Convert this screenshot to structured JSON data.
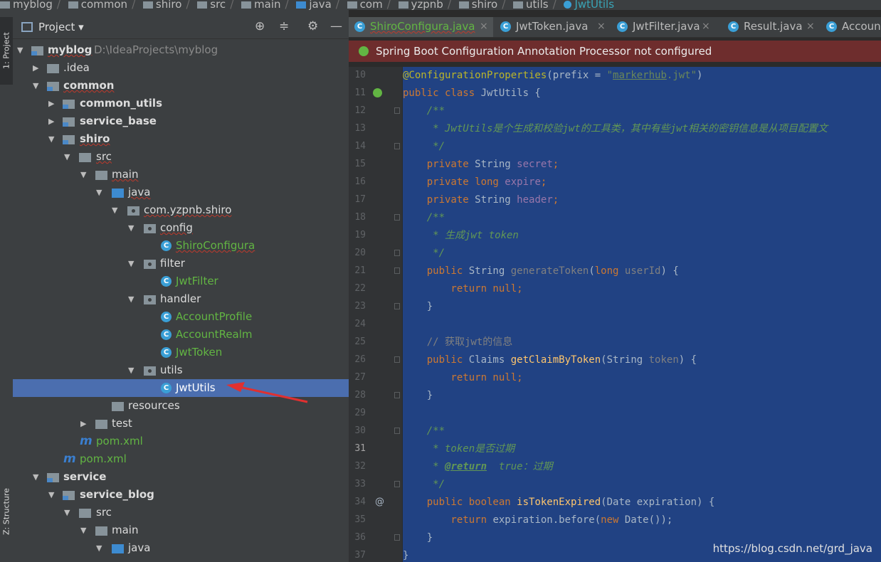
{
  "breadcrumb": {
    "items": [
      "myblog",
      "common",
      "shiro",
      "src",
      "main",
      "java",
      "com",
      "yzpnb",
      "shiro",
      "utils"
    ],
    "current": "JwtUtils"
  },
  "left_strip": {
    "project_tab": "1: Project",
    "structure_tab": "Z: Structure"
  },
  "project_panel": {
    "title": "Project",
    "tools": [
      "⊕",
      "≑",
      "⚙",
      "—"
    ],
    "root": {
      "name": "myblog",
      "path": "D:\\IdeaProjects\\myblog"
    },
    "nodes": [
      {
        "label": ".idea"
      },
      {
        "label": "common"
      },
      {
        "label": "common_utils"
      },
      {
        "label": "service_base"
      },
      {
        "label": "shiro"
      },
      {
        "label": "src"
      },
      {
        "label": "main"
      },
      {
        "label": "java"
      },
      {
        "label": "com.yzpnb.shiro"
      },
      {
        "label": "config"
      },
      {
        "label": "ShiroConfigura"
      },
      {
        "label": "filter"
      },
      {
        "label": "JwtFilter"
      },
      {
        "label": "handler"
      },
      {
        "label": "AccountProfile"
      },
      {
        "label": "AccountRealm"
      },
      {
        "label": "JwtToken"
      },
      {
        "label": "utils"
      },
      {
        "label": "JwtUtils"
      },
      {
        "label": "resources"
      },
      {
        "label": "test"
      },
      {
        "label": "pom.xml"
      },
      {
        "label": "pom.xml"
      },
      {
        "label": "service"
      },
      {
        "label": "service_blog"
      },
      {
        "label": "src"
      },
      {
        "label": "main"
      },
      {
        "label": "java"
      }
    ],
    "selected": "JwtUtils"
  },
  "editor": {
    "tabs": [
      {
        "label": "ShiroConfigura.java"
      },
      {
        "label": "JwtToken.java"
      },
      {
        "label": "JwtFilter.java"
      },
      {
        "label": "Result.java"
      },
      {
        "label": "Accoun"
      }
    ],
    "warning": "Spring Boot Configuration Annotation Processor not configured",
    "line_numbers": [
      "10",
      "11",
      "12",
      "13",
      "14",
      "15",
      "16",
      "17",
      "18",
      "19",
      "20",
      "21",
      "22",
      "23",
      "24",
      "25",
      "26",
      "27",
      "28",
      "29",
      "30",
      "31",
      "32",
      "33",
      "34",
      "35",
      "36",
      "37"
    ],
    "code": {
      "l10_ann": "@ConfigurationProperties",
      "l10_p1": "(prefix = ",
      "l10_q1": "\"",
      "l10_str": "markerhub",
      "l10_q2": ".jwt\"",
      "l10_p2": ")",
      "l11_kw": "public class ",
      "l11_rest": "JwtUtils {",
      "l12": "    /**",
      "l13": "     * JwtUtils是个生成和校验jwt的工具类，其中有些jwt相关的密钥信息是从项目配置文",
      "l14": "     */",
      "l15_kw": "    private ",
      "l15_t": "String ",
      "l15_f": "secret",
      "l15_e": ";",
      "l16_kw": "    private long ",
      "l16_f": "expire",
      "l16_e": ";",
      "l17_kw": "    private ",
      "l17_t": "String ",
      "l17_f": "header",
      "l17_e": ";",
      "l18": "    /**",
      "l19": "     * 生成jwt token",
      "l20": "     */",
      "l21_kw": "    public ",
      "l21_t": "String ",
      "l21_fn": "generateToken",
      "l21_p": "(",
      "l21_kw2": "long ",
      "l21_pp": "userId",
      "l21_e": ") {",
      "l22_kw": "        return null",
      "l22_e": ";",
      "l23": "    }",
      "l24": "",
      "l25": "    // 获取jwt的信息",
      "l26_kw": "    public ",
      "l26_t": "Claims ",
      "l26_fn": "getClaimByToken",
      "l26_p": "(String ",
      "l26_pp": "token",
      "l26_e": ") {",
      "l27_kw": "        return null",
      "l27_e": ";",
      "l28": "    }",
      "l29": "",
      "l30": "    /**",
      "l31": "     * token是否过期",
      "l32_a": "     * ",
      "l32_tag": "@return",
      "l32_b": "  true：过期",
      "l33": "     */",
      "l34_kw": "    public boolean ",
      "l34_fn": "isTokenExpired",
      "l34_e": "(Date expiration) {",
      "l35_kw": "        return ",
      "l35_a": "expiration.before(",
      "l35_kw2": "new ",
      "l35_b": "Date());",
      "l36": "    }",
      "l37": "}"
    }
  },
  "watermark": "https://blog.csdn.net/grd_java",
  "colors": {
    "selection": "#214283",
    "tree_selection": "#4b6eaf",
    "warning_bg": "#6e2d2d",
    "arrow": "#e03030"
  }
}
